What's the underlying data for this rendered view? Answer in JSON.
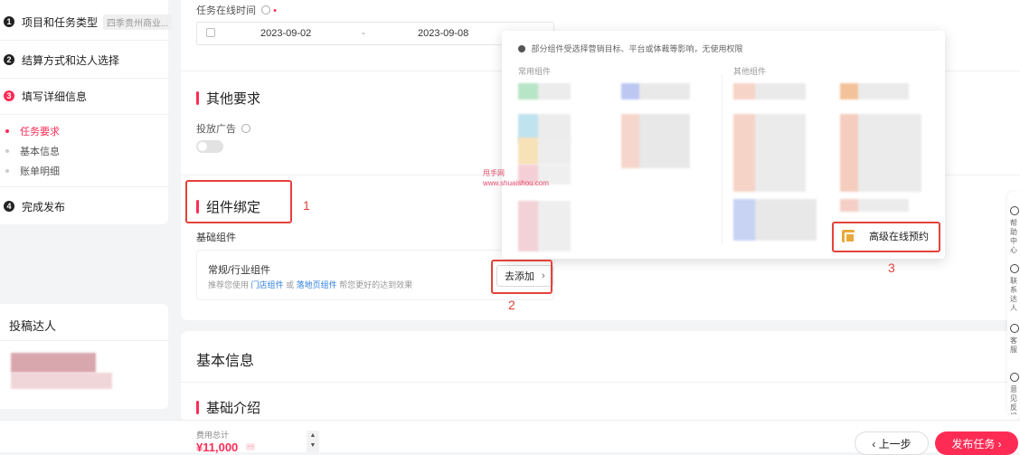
{
  "steps": [
    {
      "num": "1",
      "label": "项目和任务类型",
      "tag": "四季贵州商业..."
    },
    {
      "num": "2",
      "label": "结算方式和达人选择"
    },
    {
      "num": "3",
      "label": "填写详细信息"
    },
    {
      "num": "4",
      "label": "完成发布"
    }
  ],
  "substeps": [
    "任务要求",
    "基本信息",
    "账单明细"
  ],
  "talent_title": "投稿达人",
  "task_time": {
    "label": "任务在线时间",
    "required_mark": "•",
    "start": "2023-09-02",
    "separator": "-",
    "end": "2023-09-08"
  },
  "other_req": {
    "title": "其他要求",
    "ad_label": "投放广告"
  },
  "component": {
    "title": "组件绑定",
    "basic_label": "基础组件",
    "box_title": "常规/行业组件",
    "hint_prefix": "推荐您使用",
    "link_store": "门店组件",
    "hint_or": "或",
    "link_landing": "落地页组件",
    "hint_suffix": "帮您更好的达到效果",
    "add_button": "去添加",
    "add_chevron": "›"
  },
  "popover": {
    "notice": "部分组件受选择营销目标、平台或体裁等影响，无使用权限",
    "col_common": "常用组件",
    "col_other": "其他组件",
    "advanced_booking": "高级在线预约"
  },
  "annotations": [
    "1",
    "2",
    "3"
  ],
  "watermark": {
    "line1": "甩手网",
    "line2": "www.shuaishou.com"
  },
  "basic_info": {
    "title": "基本信息",
    "intro_title": "基础介绍"
  },
  "helpbar": [
    {
      "label": "帮助中心"
    },
    {
      "label": "联系达人"
    },
    {
      "label": "客服"
    },
    {
      "label": "意见反馈"
    }
  ],
  "footer": {
    "fee_label": "费用总计",
    "fee_value": "¥11,000",
    "fee_more": "···",
    "stepper_up": "▲",
    "stepper_down": "▼",
    "prev_label": "‹ 上一步",
    "submit_label": "发布任务 ›"
  },
  "colors": {
    "accent": "#fe2c55",
    "annotation": "#e3423b",
    "link": "#2f7fe0"
  }
}
